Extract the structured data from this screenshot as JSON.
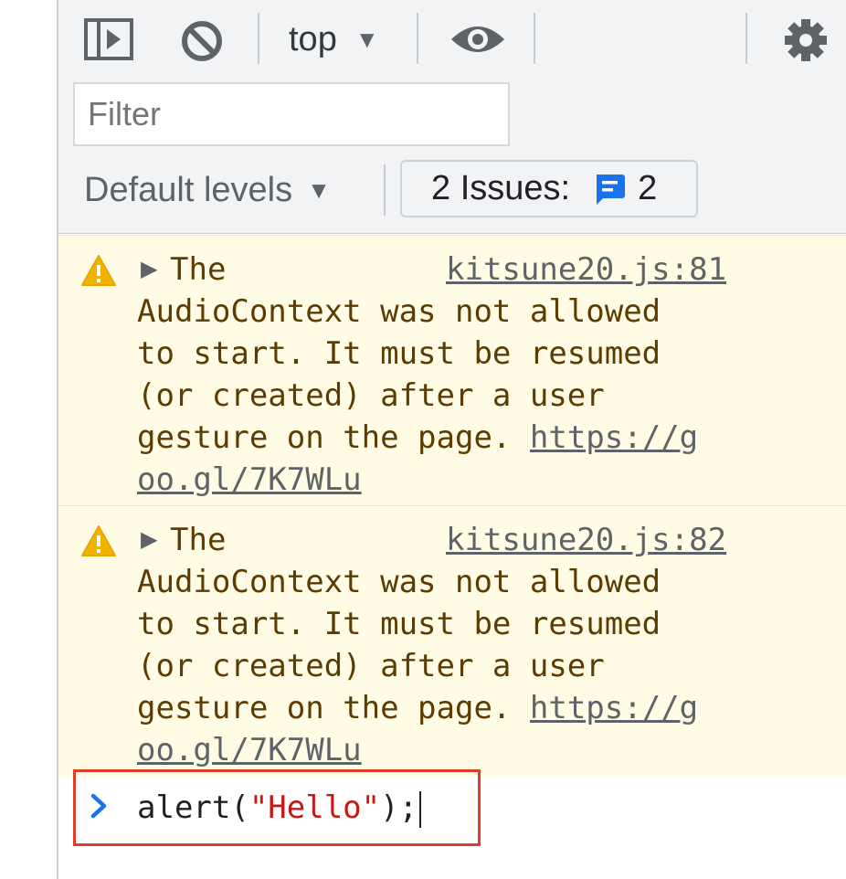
{
  "toolbar": {
    "sidebar_icon": "sidebar-toggle-icon",
    "clear_icon": "clear-console-icon",
    "context_label": "top",
    "context_arrow": "▼",
    "eye_icon": "live-expression-icon",
    "settings_icon": "gear-icon",
    "filter_placeholder": "Filter",
    "levels_label": "Default levels",
    "levels_arrow": "▼",
    "issues_label": "2 Issues:",
    "issues_count": "2"
  },
  "messages": [
    {
      "level": "warning",
      "source": "kitsune20.js:81",
      "lines": [
        "The",
        "AudioContext was not allowed",
        "to start. It must be resumed",
        "(or created) after a user",
        "gesture on the page. "
      ],
      "link_part1": "https://g",
      "link_part2": "oo.gl/7K7WLu"
    },
    {
      "level": "warning",
      "source": "kitsune20.js:82",
      "lines": [
        "The",
        "AudioContext was not allowed",
        "to start. It must be resumed",
        "(or created) after a user",
        "gesture on the page. "
      ],
      "link_part1": "https://g",
      "link_part2": "oo.gl/7K7WLu"
    }
  ],
  "prompt": {
    "code_prefix": "alert(",
    "code_string": "\"Hello\"",
    "code_suffix": ");"
  },
  "colors": {
    "warning_bg": "#fffbe5",
    "warning_text": "#5c3c00",
    "warning_icon": "#f2b300",
    "issue_blue": "#1a73e8",
    "prompt_highlight": "#e03c28",
    "string_red": "#c41a16"
  }
}
